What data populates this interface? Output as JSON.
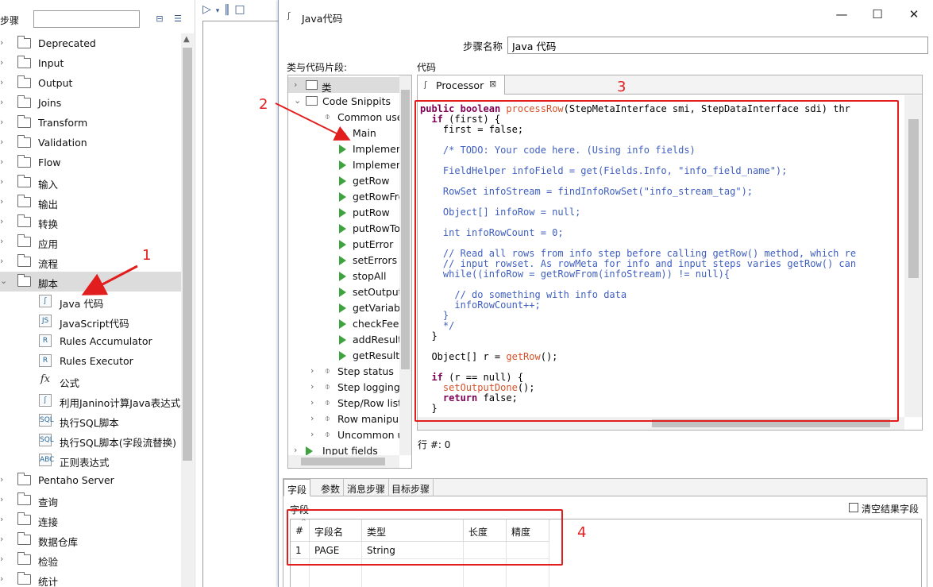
{
  "left_panel": {
    "title": "步骤",
    "search_value": "",
    "categories": [
      {
        "label": "Deprecated",
        "top": 0
      },
      {
        "label": "Input"
      },
      {
        "label": "Output"
      },
      {
        "label": "Joins"
      },
      {
        "label": "Transform"
      },
      {
        "label": "Validation"
      },
      {
        "label": "Flow"
      },
      {
        "label": "输入"
      },
      {
        "label": "输出"
      },
      {
        "label": "转换"
      },
      {
        "label": "应用"
      },
      {
        "label": "流程"
      },
      {
        "label": "脚本"
      }
    ],
    "script_items": [
      {
        "label": "Java 代码"
      },
      {
        "label": "JavaScript代码"
      },
      {
        "label": "Rules Accumulator"
      },
      {
        "label": "Rules Executor"
      },
      {
        "label": "公式"
      },
      {
        "label": "利用Janino计算Java表达式"
      },
      {
        "label": "执行SQL脚本"
      },
      {
        "label": "执行SQL脚本(字段流替换)"
      },
      {
        "label": "正则表达式"
      }
    ],
    "more_categories": [
      {
        "label": "Pentaho Server"
      },
      {
        "label": "查询"
      },
      {
        "label": "连接"
      },
      {
        "label": "数据仓库"
      },
      {
        "label": "检验"
      },
      {
        "label": "统计"
      }
    ]
  },
  "dialog": {
    "title": "Java代码",
    "step_name_label": "步骤名称",
    "step_name_value": "Java 代码",
    "snippets_label": "类与代码片段:",
    "code_label": "代码",
    "row_label": "行 #: 0",
    "snippets": {
      "root": "类",
      "code_snippets": "Code Snippits",
      "common_use": "Common use",
      "common_items": [
        "Main",
        "Implemen",
        "Implemen",
        "getRow",
        "getRowFro",
        "putRow",
        "putRowTo",
        "putError",
        "setErrors",
        "stopAll",
        "setOutput",
        "getVariab",
        "checkFeed",
        "addResult",
        "getResultF"
      ],
      "groups": [
        "Step status",
        "Step logging",
        "Step/Row list",
        "Row manipula",
        "Uncommon u"
      ],
      "input_fields": "Input fields"
    },
    "code_tab": "Processor",
    "code_lines": [
      "public boolean processRow(StepMetaInterface smi, StepDataInterface sdi) thr",
      "  if (first) {",
      "    first = false;",
      "",
      "    /* TODO: Your code here. (Using info fields)",
      "",
      "    FieldHelper infoField = get(Fields.Info, \"info_field_name\");",
      "",
      "    RowSet infoStream = findInfoRowSet(\"info_stream_tag\");",
      "",
      "    Object[] infoRow = null;",
      "",
      "    int infoRowCount = 0;",
      "",
      "    // Read all rows from info step before calling getRow() method, which re",
      "    // input rowset. As rowMeta for info and input steps varies getRow() can",
      "    while((infoRow = getRowFrom(infoStream)) != null){",
      "",
      "      // do something with info data",
      "      infoRowCount++;",
      "    }",
      "    */",
      "  }",
      "",
      "  Object[] r = getRow();",
      "",
      "  if (r == null) {",
      "    setOutputDone();",
      "    return false;",
      "  }"
    ],
    "bottom_tabs": [
      "字段",
      "参数",
      "消息步骤",
      "目标步骤"
    ],
    "fields_label": "字段",
    "clear_result_label": "清空结果字段",
    "table": {
      "headers": [
        "#",
        "字段名",
        "类型",
        "长度",
        "精度"
      ],
      "rows": [
        [
          "1",
          "PAGE",
          "String",
          "",
          ""
        ]
      ]
    }
  },
  "annotations": {
    "labels": [
      "1",
      "2",
      "3",
      "4"
    ],
    "color": "#e21d1d"
  },
  "window_buttons": {
    "minimize": "—",
    "maximize": "☐",
    "close": "✕"
  },
  "canvas_toolbar": [
    "▷",
    "▾",
    "‖",
    "□"
  ]
}
